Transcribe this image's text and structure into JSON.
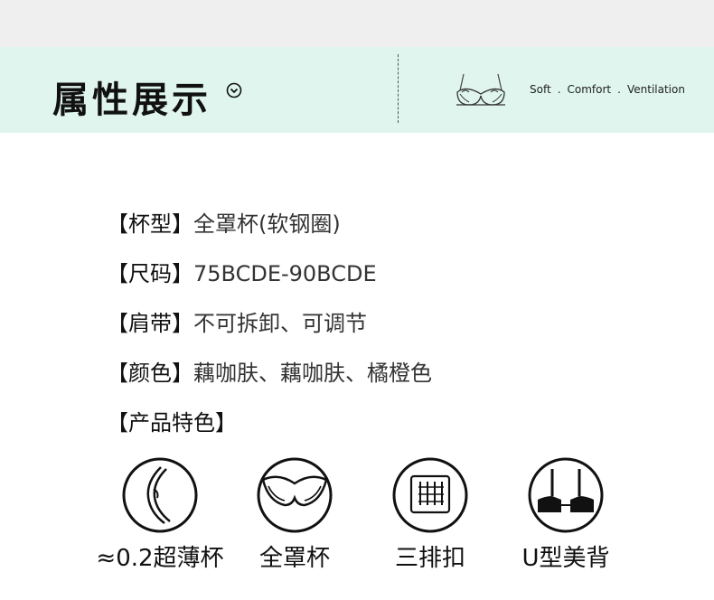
{
  "header": {
    "title": "属性展示",
    "tagline": [
      "Soft",
      "Comfort",
      "Ventilation"
    ],
    "tagline_sep": "."
  },
  "attributes": [
    {
      "key": "【杯型】",
      "value": "全罩杯(软钢圈)"
    },
    {
      "key": "【尺码】",
      "value": "75BCDE-90BCDE"
    },
    {
      "key": "【肩带】",
      "value": "不可拆卸、可调节"
    },
    {
      "key": "【颜色】",
      "value": "藕咖肤、藕咖肤、橘橙色"
    },
    {
      "key": "【产品特色】",
      "value": ""
    }
  ],
  "features": [
    {
      "icon": "thin-cup-icon",
      "label": "≈0.2超薄杯"
    },
    {
      "icon": "full-cup-icon",
      "label": "全罩杯"
    },
    {
      "icon": "three-hook-icon",
      "label": "三排扣"
    },
    {
      "icon": "u-back-icon",
      "label": "U型美背"
    }
  ],
  "colors": {
    "banner": "#dff5ee",
    "topbar": "#efefef"
  }
}
